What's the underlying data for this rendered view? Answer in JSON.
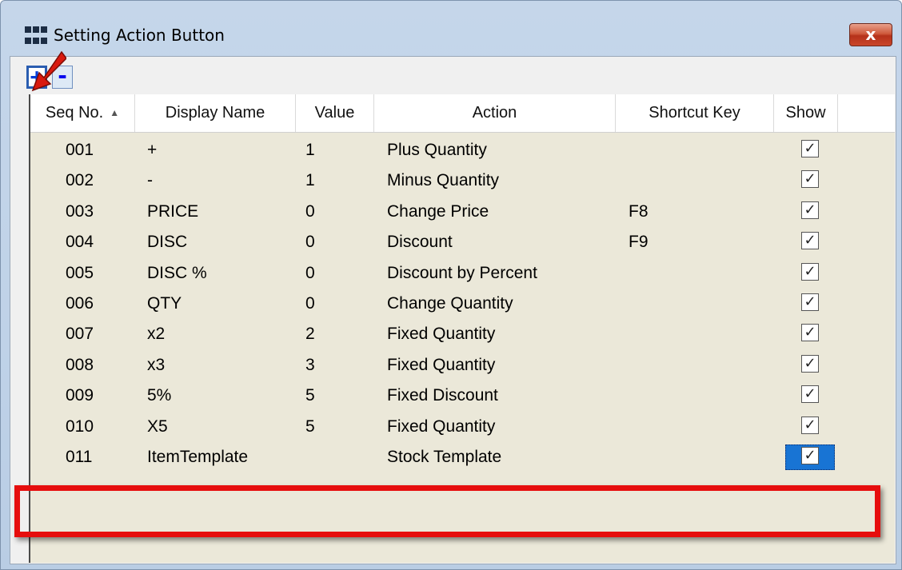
{
  "window": {
    "title": "Setting Action Button",
    "close_label": "x"
  },
  "toolbar": {
    "add_label": "+",
    "remove_label": "-"
  },
  "grid": {
    "columns": [
      "Seq No.",
      "Display Name",
      "Value",
      "Action",
      "Shortcut Key",
      "Show"
    ],
    "sorted_column": "Seq No.",
    "rows": [
      {
        "seq": "001",
        "name": "+",
        "value": "1",
        "action": "Plus Quantity",
        "shortcut": "",
        "show": true
      },
      {
        "seq": "002",
        "name": "-",
        "value": "1",
        "action": "Minus Quantity",
        "shortcut": "",
        "show": true
      },
      {
        "seq": "003",
        "name": "PRICE",
        "value": "0",
        "action": "Change Price",
        "shortcut": "F8",
        "show": true
      },
      {
        "seq": "004",
        "name": "DISC",
        "value": "0",
        "action": "Discount",
        "shortcut": "F9",
        "show": true
      },
      {
        "seq": "005",
        "name": "DISC %",
        "value": "0",
        "action": "Discount by Percent",
        "shortcut": "",
        "show": true
      },
      {
        "seq": "006",
        "name": "QTY",
        "value": "0",
        "action": "Change Quantity",
        "shortcut": "",
        "show": true
      },
      {
        "seq": "007",
        "name": "x2",
        "value": "2",
        "action": "Fixed Quantity",
        "shortcut": "",
        "show": true
      },
      {
        "seq": "008",
        "name": "x3",
        "value": "3",
        "action": "Fixed Quantity",
        "shortcut": "",
        "show": true
      },
      {
        "seq": "009",
        "name": "5%",
        "value": "5",
        "action": "Fixed Discount",
        "shortcut": "",
        "show": true
      },
      {
        "seq": "010",
        "name": "X5",
        "value": "5",
        "action": "Fixed Quantity",
        "shortcut": "",
        "show": true
      },
      {
        "seq": "011",
        "name": "ItemTemplate",
        "value": "",
        "action": "Stock Template",
        "shortcut": "",
        "show": true,
        "selected": true
      }
    ]
  },
  "colors": {
    "highlight_box": "#e60d0d",
    "selection": "#1874d4",
    "grid_background": "#ebe8d9"
  }
}
